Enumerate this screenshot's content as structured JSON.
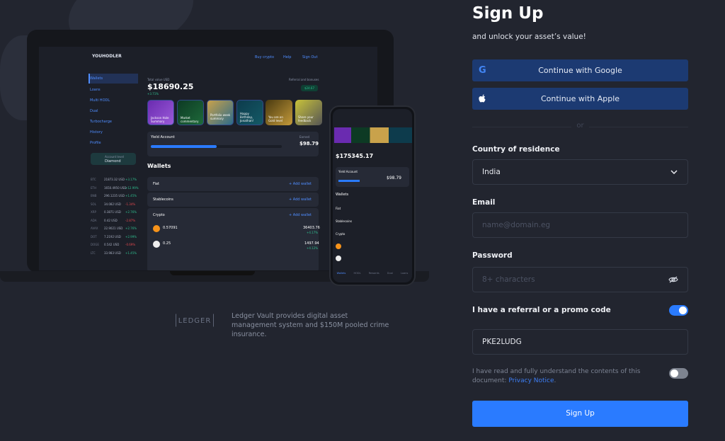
{
  "colors": {
    "background": "#22252f",
    "social_button": "#1c3a72",
    "primary": "#2a7bff",
    "link": "#3d7ef5",
    "toggle_on": "#2a7bff",
    "toggle_off": "#7d838f"
  },
  "mockup": {
    "brand": "YOUHODLER",
    "header_buttons": [
      "Buy crypto",
      "Help",
      "Sign Out"
    ],
    "sidebar": [
      "Wallets",
      "Loans",
      "Multi HODL",
      "Dual",
      "Turbocharge",
      "History",
      "Profile"
    ],
    "level": {
      "label": "Account level",
      "value": "Diamond"
    },
    "tickers": [
      [
        "BTC",
        "21873.32 USD",
        "+3.17%"
      ],
      [
        "ETH",
        "1650.4950 USD",
        "+12.99%"
      ],
      [
        "BNB",
        "296.1235 USD",
        "+1.45%"
      ],
      [
        "SOL",
        "34.082 USD",
        "-1.34%"
      ],
      [
        "XRP",
        "0.3871 USD",
        "+2.76%"
      ],
      [
        "ADA",
        "0.42 USD",
        "-2.87%"
      ],
      [
        "AVAX",
        "22.9021 USD",
        "+2.76%"
      ],
      [
        "DOT",
        "7.2192 USD",
        "+2.99%"
      ],
      [
        "DOGE",
        "0.542 USD",
        "-0.69%"
      ],
      [
        "LTC",
        "33.983 USD",
        "+1.45%"
      ]
    ],
    "total_label": "Total value USD",
    "total": "$18690.25",
    "total_change": "+3.71%",
    "referral_label": "Referral and bonuses",
    "referral_value": "$24.67",
    "stories": [
      "Jackson Hole Summary",
      "Market commentary",
      "Portfolio week summary",
      "Happy Birthday, Jonathan!",
      "You are on Gold level",
      "Share your feedback"
    ],
    "yield": {
      "title": "Yield Account",
      "earned_label": "Earned",
      "earned": "$98.79",
      "progress_percent": 50
    },
    "wallets_title": "Wallets",
    "wallet_groups": [
      "Fiat",
      "Stablecoins",
      "Crypto"
    ],
    "add_wallet": "+ Add wallet",
    "coins": [
      {
        "amount": "0.57091",
        "sym": "BTC",
        "value": "36403.76",
        "change": "+4.17%"
      },
      {
        "amount": "0.25",
        "sym": "ETH",
        "value": "1497.94",
        "change": "+4.12%"
      }
    ],
    "phone_total": "$175345.17",
    "phone_tabs": [
      "Wallets",
      "HODL",
      "Rewards",
      "Dual",
      "Loans"
    ]
  },
  "ledger": {
    "logo": "LEDGER",
    "text": "Ledger Vault provides digital asset management system and $150M pooled crime insurance."
  },
  "form": {
    "title": "Sign Up",
    "subtitle": "and unlock your asset’s value!",
    "google": "Continue with Google",
    "apple": "Continue with Apple",
    "or": "or",
    "country_label": "Country of residence",
    "country_value": "India",
    "email_label": "Email",
    "email_placeholder": "name@domain.eg",
    "password_label": "Password",
    "password_placeholder": "8+ characters",
    "referral_label": "I have a referral or a promo code",
    "referral_enabled": true,
    "promo_value": "PKE2LUDG",
    "privacy_text": "I have read and fully understand the contents of this document: ",
    "privacy_link": "Privacy Notice",
    "privacy_accepted": false,
    "submit": "Sign Up"
  }
}
